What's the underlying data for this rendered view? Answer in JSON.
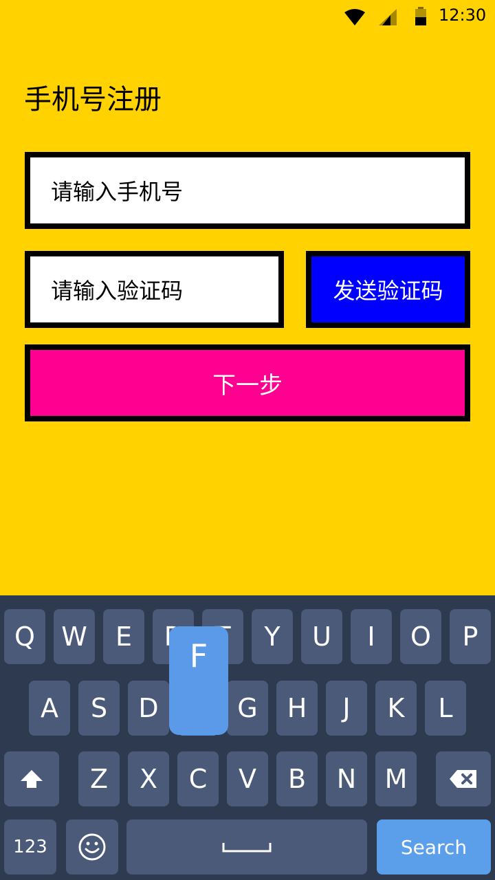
{
  "status_bar": {
    "time": "12:30",
    "icons": [
      "wifi-icon",
      "signal-icon",
      "battery-icon"
    ]
  },
  "page": {
    "title": "手机号注册",
    "phone_placeholder": "请输入手机号",
    "code_placeholder": "请输入验证码",
    "send_code_label": "发送验证码",
    "next_label": "下一步"
  },
  "keyboard": {
    "row1": [
      "Q",
      "W",
      "E",
      "R",
      "T",
      "Y",
      "U",
      "I",
      "O",
      "P"
    ],
    "row2": [
      "A",
      "S",
      "D",
      "F",
      "G",
      "H",
      "J",
      "K",
      "L"
    ],
    "row3": [
      "Z",
      "X",
      "C",
      "V",
      "B",
      "N",
      "M"
    ],
    "numbers_label": "123",
    "search_label": "Search",
    "pressed_key": "F"
  },
  "colors": {
    "background": "#FFD200",
    "send_button": "#0000FF",
    "next_button": "#FF0090",
    "keyboard": "#2E3A50",
    "key": "#4A5A78",
    "accent_key": "#5B9FEA"
  }
}
